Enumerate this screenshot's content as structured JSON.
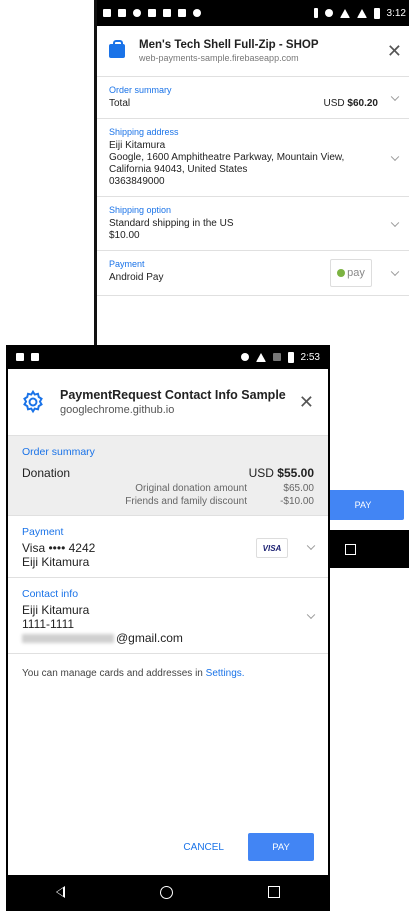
{
  "back": {
    "status_time": "3:12",
    "title": "Men's Tech Shell Full-Zip - SHOP",
    "subtitle": "web-payments-sample.firebaseapp.com",
    "order_summary": {
      "label": "Order summary",
      "total_label": "Total",
      "currency": "USD",
      "amount": "$60.20"
    },
    "shipping_address": {
      "label": "Shipping address",
      "lines": [
        "Eiji Kitamura",
        "Google, 1600 Amphitheatre Parkway, Mountain View,",
        "California 94043, United States",
        "0363849000"
      ]
    },
    "shipping_option": {
      "label": "Shipping option",
      "lines": [
        "Standard shipping in the US",
        "$10.00"
      ]
    },
    "payment": {
      "label": "Payment",
      "method": "Android Pay",
      "chip_text": "pay"
    },
    "pay_label": "PAY"
  },
  "front": {
    "status_time": "2:53",
    "title": "PaymentRequest Contact Info Sample",
    "subtitle": "googlechrome.github.io",
    "order_summary": {
      "label": "Order summary",
      "item": "Donation",
      "currency": "USD",
      "amount": "$55.00",
      "rows": [
        {
          "label": "Original donation amount",
          "value": "$65.00"
        },
        {
          "label": "Friends and family discount",
          "value": "-$10.00"
        }
      ]
    },
    "payment": {
      "label": "Payment",
      "card": "Visa •••• 4242",
      "name": "Eiji Kitamura",
      "card_badge": "VISA"
    },
    "contact": {
      "label": "Contact info",
      "name": "Eiji Kitamura",
      "phone": "1111-1111",
      "email_suffix": "@gmail.com"
    },
    "note_text": "You can manage cards and addresses in ",
    "note_link": "Settings.",
    "cancel_label": "CANCEL",
    "pay_label": "PAY"
  }
}
